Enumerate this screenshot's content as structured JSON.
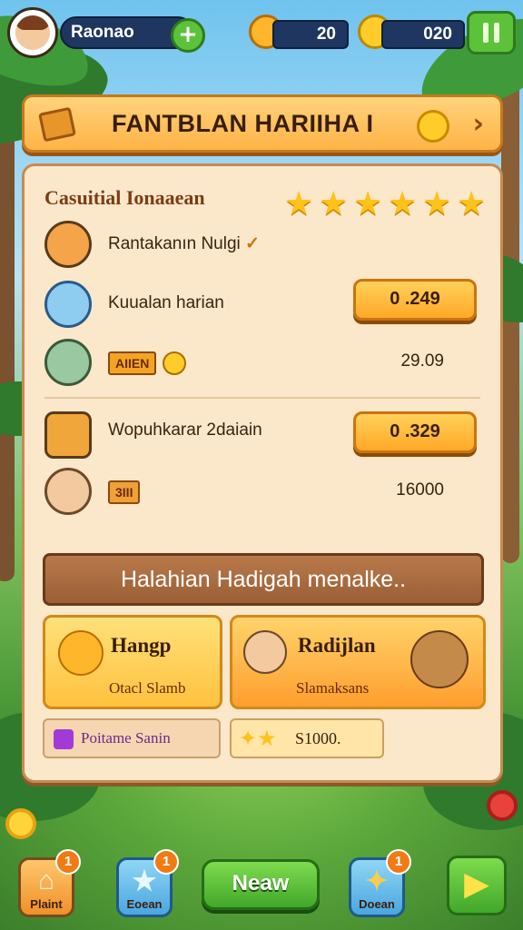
{
  "topbar": {
    "player_name": "Raonao",
    "plus_label": "+",
    "stamina_value": "20",
    "coin_value": "020"
  },
  "banner": {
    "title": "FANTBLAN HARIIHA I",
    "chevron": "›"
  },
  "panel": {
    "section_title": "Casuitial Ionaaean",
    "star_count": 6,
    "star_glyph": "★",
    "rows": [
      {
        "label": "Rantakanın Nulgi",
        "check": "✓"
      },
      {
        "label": "Kuualan harian",
        "value": "0 .249"
      },
      {
        "badge": "AIIEN",
        "value": "29.09"
      },
      {
        "label": "Wopuhkarar 2daiain",
        "value": "0 .329"
      },
      {
        "badge": "3III",
        "value": "16000"
      }
    ],
    "rewards_header": "Halahian Hadigah menalke..",
    "rewards": [
      {
        "title": "Hangp",
        "sub": "Otacl Slamb"
      },
      {
        "title": "Radijlan",
        "sub": "Slamaksans"
      }
    ],
    "bars": [
      {
        "label": "Poitame Sanin"
      },
      {
        "label": "S1000."
      }
    ]
  },
  "bottom_nav": {
    "items": [
      {
        "label": "Plaint",
        "notif": "1",
        "glyph": "⌂"
      },
      {
        "label": "Eoean",
        "notif": "1",
        "glyph": "★"
      },
      {
        "label": "Doean",
        "notif": "1",
        "glyph": "✦"
      }
    ],
    "new_label": "Neaw",
    "play_glyph": "▶"
  },
  "colors": {
    "accent_orange": "#ffb347",
    "panel_bg": "#fbe7c9",
    "button_green": "#42a82a",
    "pill_navy": "#1f3760"
  },
  "icons": [
    "avatar",
    "plus-icon",
    "sun-icon",
    "coin-icon",
    "pause-icon",
    "ticket-icon",
    "chevron-right-icon",
    "star-icon",
    "scroll-icon",
    "envelope-icon",
    "basket-icon",
    "chest-icon",
    "play-icon"
  ]
}
